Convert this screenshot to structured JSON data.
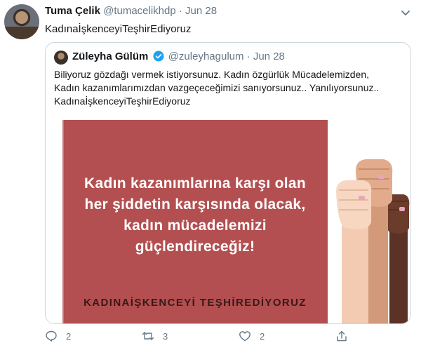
{
  "tweet": {
    "author_name": "Tuma Çelik",
    "handle": "@tumacelikhdp",
    "separator": " · ",
    "date": "Jun 28",
    "text": "KadınaİşkenceyiTeşhirEdiyoruz"
  },
  "quoted": {
    "author_name": "Züleyha Gülüm",
    "handle": "@zuleyhagulum",
    "separator": " · ",
    "date": "Jun 28",
    "text_lines": [
      "Biliyoruz gözdağı vermek istiyorsunuz. Kadın özgürlük Mücadelemizden,",
      "Kadın kazanımlarımızdan vazgeçeceğimizi sanıyorsunuz.. Yanılıyorsunuz..",
      "KadınaİşkenceyiTeşhirEdiyoruz"
    ],
    "image": {
      "slogan_lines": [
        "Kadın kazanımlarına karşı olan",
        "her şiddetin karşısında olacak,",
        "kadın mücadelemizi",
        "güçlendireceğiz!"
      ],
      "hashtag": "KADINAİŞKENCEYİ TEŞHİREDİYORUZ",
      "panel_color": "#b34f50"
    }
  },
  "actions": {
    "reply_count": "2",
    "retweet_count": "3",
    "like_count": "2"
  },
  "icons": [
    "chevron-down-icon",
    "verified-badge-icon",
    "reply-icon",
    "retweet-icon",
    "like-icon",
    "share-icon"
  ],
  "colors": {
    "muted": "#657786",
    "verified": "#1da1f2"
  }
}
